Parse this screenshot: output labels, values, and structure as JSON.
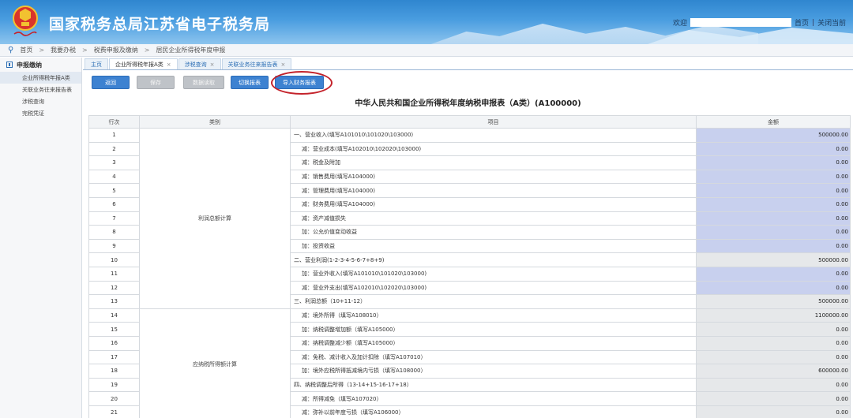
{
  "header": {
    "title": "国家税务总局江苏省电子税务局",
    "greeting": "欢迎",
    "links": {
      "home": "首页",
      "close": "关闭当前"
    },
    "sep": "|"
  },
  "breadcrumb": [
    "首页",
    "我要办税",
    "税费申报及缴纳",
    "居民企业所得税年度申报"
  ],
  "sidebar": {
    "heading": "申报缴纳",
    "items": [
      "企业所得税年报A类",
      "关联业务往来报告表",
      "涉税查询",
      "完税凭证"
    ]
  },
  "tabs": [
    {
      "label": "主页",
      "closable": false
    },
    {
      "label": "企业所得税年报A类",
      "closable": true
    },
    {
      "label": "涉税查询",
      "closable": true
    },
    {
      "label": "关联业务往来报告表",
      "closable": true
    }
  ],
  "toolbar": {
    "return": "返回",
    "save": "保存",
    "fetch": "数据读取",
    "switch": "切换报表",
    "import": "导入财务报表"
  },
  "form": {
    "title": "中华人民共和国企业所得税年度纳税申报表（A类）(A100000)",
    "columns": [
      "行次",
      "类别",
      "项目",
      "金额"
    ],
    "categories": [
      "利润总额计算",
      "应纳税所得额计算"
    ],
    "rows": [
      {
        "n": "1",
        "item": "一、营业收入(填写A101010\\101020\\103000)",
        "amount": "500000.00",
        "style": "edit"
      },
      {
        "n": "2",
        "item": "减：营业成本(填写A102010\\102020\\103000)",
        "amount": "0.00",
        "style": "edit"
      },
      {
        "n": "3",
        "item": "减：税金及附加",
        "amount": "0.00",
        "style": "edit"
      },
      {
        "n": "4",
        "item": "减：销售费用(填写A104000)",
        "amount": "0.00",
        "style": "edit"
      },
      {
        "n": "5",
        "item": "减：管理费用(填写A104000)",
        "amount": "0.00",
        "style": "edit"
      },
      {
        "n": "6",
        "item": "减：财务费用(填写A104000)",
        "amount": "0.00",
        "style": "edit"
      },
      {
        "n": "7",
        "item": "减：资产减值损失",
        "amount": "0.00",
        "style": "edit"
      },
      {
        "n": "8",
        "item": "加：公允价值变动收益",
        "amount": "0.00",
        "style": "edit"
      },
      {
        "n": "9",
        "item": "加：投资收益",
        "amount": "0.00",
        "style": "edit"
      },
      {
        "n": "10",
        "item": "二、营业利润(1-2-3-4-5-6-7+8+9)",
        "amount": "500000.00",
        "style": "calc"
      },
      {
        "n": "11",
        "item": "加：营业外收入(填写A101010\\101020\\103000)",
        "amount": "0.00",
        "style": "edit"
      },
      {
        "n": "12",
        "item": "减：营业外支出(填写A102010\\102020\\103000)",
        "amount": "0.00",
        "style": "edit"
      },
      {
        "n": "13",
        "item": "三、利润总额（10+11-12）",
        "amount": "500000.00",
        "style": "calc"
      },
      {
        "n": "14",
        "item": "减：境外所得（填写A108010）",
        "amount": "1100000.00",
        "style": "calc"
      },
      {
        "n": "15",
        "item": "加：纳税调整增加额（填写A105000）",
        "amount": "0.00",
        "style": "calc"
      },
      {
        "n": "16",
        "item": "减：纳税调整减少额（填写A105000）",
        "amount": "0.00",
        "style": "calc"
      },
      {
        "n": "17",
        "item": "减：免税、减计收入及加计扣除（填写A107010）",
        "amount": "0.00",
        "style": "calc"
      },
      {
        "n": "18",
        "item": "加：境外应税所得抵减境内亏损（填写A108000）",
        "amount": "600000.00",
        "style": "calc"
      },
      {
        "n": "19",
        "item": "四、纳税调整后所得（13-14+15-16-17+18）",
        "amount": "0.00",
        "style": "calc"
      },
      {
        "n": "20",
        "item": "减：所得减免（填写A107020）",
        "amount": "0.00",
        "style": "calc"
      },
      {
        "n": "21",
        "item": "减：弥补以前年度亏损（填写A106000）",
        "amount": "0.00",
        "style": "calc"
      }
    ]
  },
  "colors": {
    "accent": "#3d82d1",
    "highlight_circle": "#c4232b",
    "editable_cell": "#c8d0ee",
    "computed_cell": "#e6e8ea"
  }
}
